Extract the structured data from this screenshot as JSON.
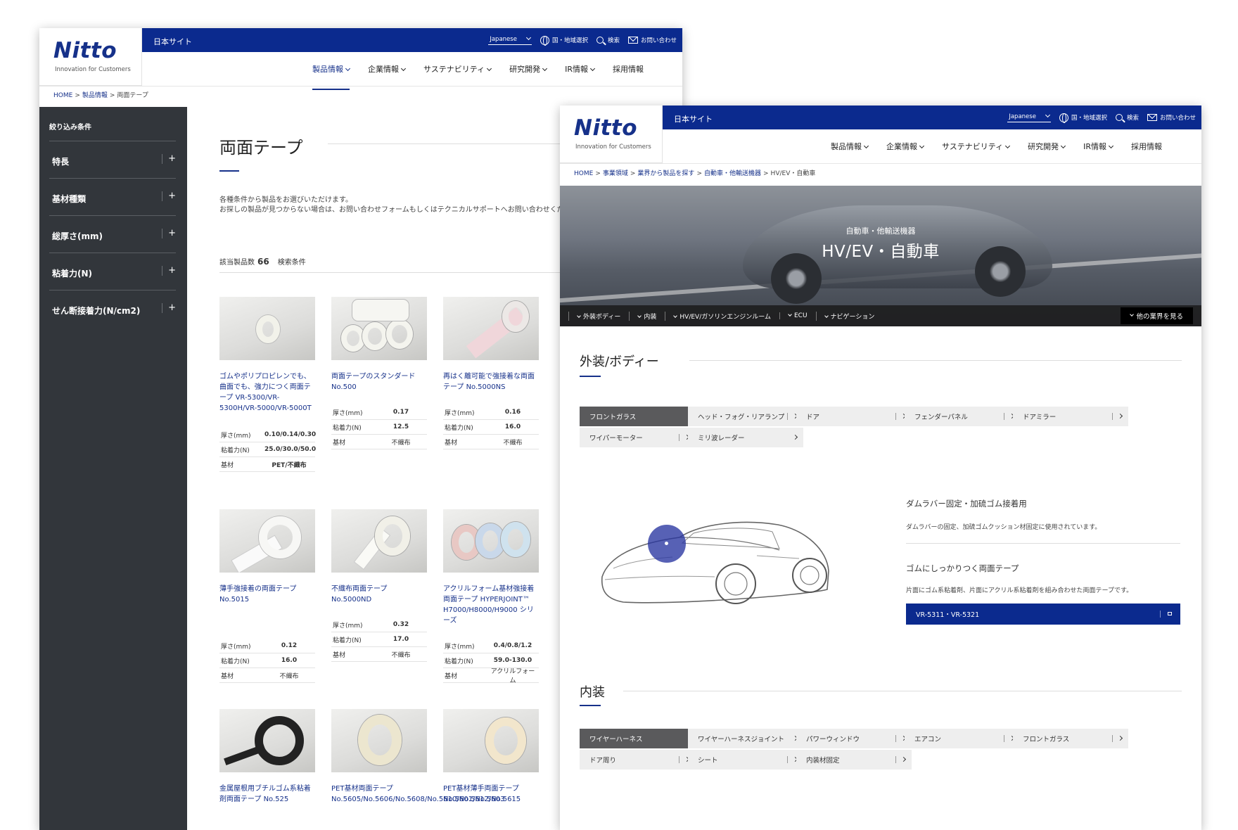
{
  "colors": {
    "brand_blue": "#0b2a8e",
    "sidebar_dark": "#32363b",
    "link_blue": "#16318a",
    "selected_chip": "#5a5a5c"
  },
  "left": {
    "logo": {
      "word": "Nitto",
      "tagline": "Innovation for Customers"
    },
    "topbar": {
      "site": "日本サイト",
      "language": "Japanese",
      "region": "国・地域選択",
      "search": "検索",
      "contact": "お問い合わせ"
    },
    "nav": [
      "製品情報",
      "企業情報",
      "サステナビリティ",
      "研究開発",
      "IR情報",
      "採用情報"
    ],
    "breadcrumb": {
      "home": "HOME",
      "products": "製品情報",
      "current": "両面テープ",
      "sep": ">"
    },
    "sidebar": {
      "title": "絞り込み条件",
      "facets": [
        "特長",
        "基材種類",
        "総厚さ(mm)",
        "粘着力(N)",
        "せん断接着力(N/cm2)"
      ],
      "plus": "+"
    },
    "title": "両面テープ",
    "desc1": "各種条件から製品をお選びいただけます。",
    "desc2": "お探しの製品が見つからない場合は、お問い合わせフォームもしくはテクニカルサポートへお問い合わせください。",
    "count_label": "該当製品数",
    "count": "66",
    "search_cond": "検索条件",
    "spec_labels": {
      "thickness": "厚さ(mm)",
      "adhesion": "粘着力(N)",
      "base": "基材"
    },
    "products": [
      {
        "name": "ゴムやポリプロピレンでも、曲面でも、強力につく両面テープ VR-5300/VR-5300H/VR-5000/VR-5000T",
        "thickness": "0.10/0.14/0.30",
        "adhesion": "25.0/30.0/50.0",
        "base": "PET/不織布"
      },
      {
        "name": "両面テープのスタンダード No.500",
        "thickness": "0.17",
        "adhesion": "12.5",
        "base": "不織布"
      },
      {
        "name": "再はく離可能で強接着な両面テープ No.5000NS",
        "thickness": "0.16",
        "adhesion": "16.0",
        "base": "不織布"
      },
      {
        "name": "薄手強接着の両面テープ No.5015",
        "thickness": "0.12",
        "adhesion": "16.0",
        "base": "不織布"
      },
      {
        "name": "不織布両面テープ No.5000ND",
        "thickness": "0.32",
        "adhesion": "17.0",
        "base": "不織布"
      },
      {
        "name": "アクリルフォーム基材強接着両面テープ HYPERJOINT™ H7000/H8000/H9000 シリーズ",
        "thickness": "0.4/0.8/1.2",
        "adhesion": "59.0-130.0",
        "base": "アクリルフォーム"
      },
      {
        "name": "金属屋根用ブチルゴム系粘着剤両面テープ No.525"
      },
      {
        "name": "PET基材両面テープ No.5605/No.5606/No.5608/No.5610/No.5612/No.5615"
      },
      {
        "name": "PET基材薄手両面テープ No.5601/No.5603"
      }
    ]
  },
  "right": {
    "logo": {
      "word": "Nitto",
      "tagline": "Innovation for Customers"
    },
    "topbar": {
      "site": "日本サイト",
      "language": "Japanese",
      "region": "国・地域選択",
      "search": "検索",
      "contact": "お問い合わせ"
    },
    "nav": [
      "製品情報",
      "企業情報",
      "サステナビリティ",
      "研究開発",
      "IR情報",
      "採用情報"
    ],
    "breadcrumb": [
      "HOME",
      "事業領域",
      "業界から製品を探す",
      "自動車・他輸送機器",
      "HV/EV・自動車"
    ],
    "hero": {
      "sub": "自動車・他輸送機器",
      "title": "HV/EV・自動車",
      "tabs": [
        "外装ボディー",
        "内装",
        "HV/EV/ガソリンエンジンルーム",
        "ECU",
        "ナビゲーション"
      ],
      "more": "他の業界を見る"
    },
    "sections": [
      {
        "title": "外装/ボディー",
        "chips": [
          "フロントガラス",
          "ヘッド・フォグ・リアランプ",
          "ドア",
          "フェンダーパネル",
          "ドアミラー",
          "ワイパーモーター",
          "ミリ波レーダー"
        ]
      },
      {
        "title": "内装",
        "chips": [
          "ワイヤーハーネス",
          "ワイヤーハーネスジョイント",
          "パワーウィンドウ",
          "エアコン",
          "フロントガラス",
          "ドア周り",
          "シート",
          "内装材固定"
        ]
      }
    ],
    "detail": {
      "heading1": "ダムラバー固定・加硫ゴム接着用",
      "text1": "ダムラバーの固定、加硫ゴムクッション材固定に使用されています。",
      "heading2": "ゴムにしっかりつく両面テープ",
      "text2": "片面にゴム系粘着剤、片面にアクリル系粘着剤を組み合わせた両面テープです。",
      "button": "VR-5311・VR-5321"
    }
  }
}
